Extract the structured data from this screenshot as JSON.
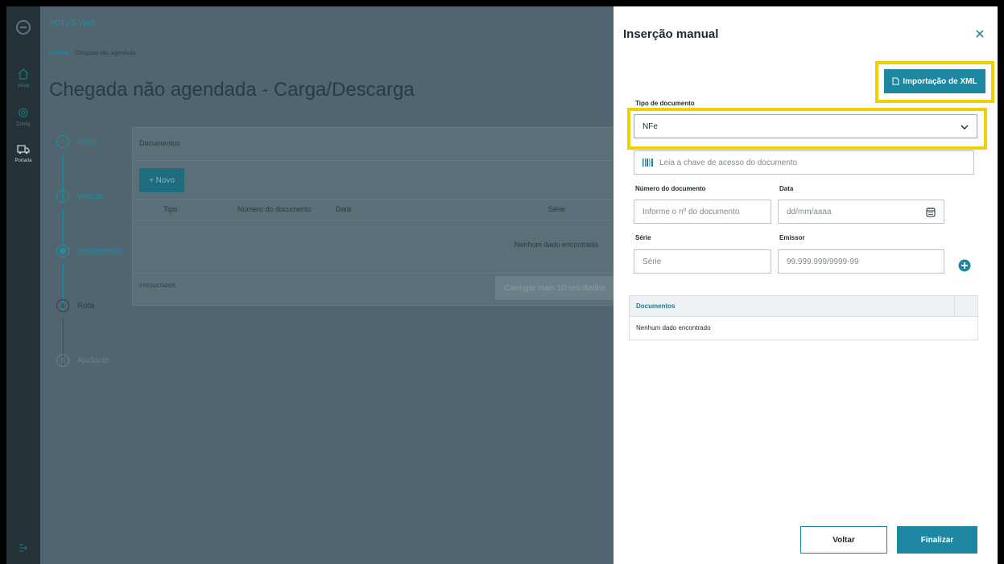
{
  "app": {
    "name": "TOTVS YMS",
    "breadcrumb": [
      "Portaria",
      "Chegada não agendada"
    ],
    "page_title": "Chegada não agendada - Carga/Descarga"
  },
  "rail": {
    "items": [
      {
        "label": "Início",
        "icon": "home-icon"
      },
      {
        "label": "Config",
        "icon": "gear-icon"
      },
      {
        "label": "Portaria",
        "icon": "truck-icon",
        "active": true
      }
    ]
  },
  "stepper": {
    "steps": [
      {
        "label": "Início",
        "state": "done",
        "marker": ""
      },
      {
        "label": "Veículo",
        "state": "done",
        "marker": ""
      },
      {
        "label": "Documentos",
        "state": "current",
        "marker": ""
      },
      {
        "label": "Rota",
        "state": "todo",
        "marker": "4"
      },
      {
        "label": "Ajudante",
        "state": "dim",
        "marker": "5"
      }
    ]
  },
  "documents_card": {
    "title": "Documentos",
    "new_button": "+ Novo",
    "columns": [
      "Tipo",
      "Número do documento",
      "Data",
      "Série"
    ],
    "empty_message": "Nenhum dado encontrado",
    "results_count": "0 RESULTADOS",
    "load_more_button": "Carregar mais 10 resultados"
  },
  "modal": {
    "title": "Inserção manual",
    "xml_button": "Importação de XML",
    "doc_type": {
      "label": "Tipo de documento",
      "value": "NFe"
    },
    "access_key": {
      "placeholder": "Leia a chave de acesso do documento"
    },
    "doc_number": {
      "label": "Número do documento",
      "placeholder": "Informe o nº do documento"
    },
    "date": {
      "label": "Data",
      "placeholder": "dd/mm/aaaa"
    },
    "series": {
      "label": "Série",
      "placeholder": "Série"
    },
    "issuer": {
      "label": "Emissor",
      "placeholder": "99.999.999/9999-99"
    },
    "table": {
      "header": "Documentos",
      "empty_message": "Nenhum dado encontrado"
    },
    "back_button": "Voltar",
    "finish_button": "Finalizar"
  },
  "colors": {
    "accent": "#1d87a1",
    "highlight": "#f0d000",
    "overlay": "#50656f",
    "rail": "#253238"
  }
}
